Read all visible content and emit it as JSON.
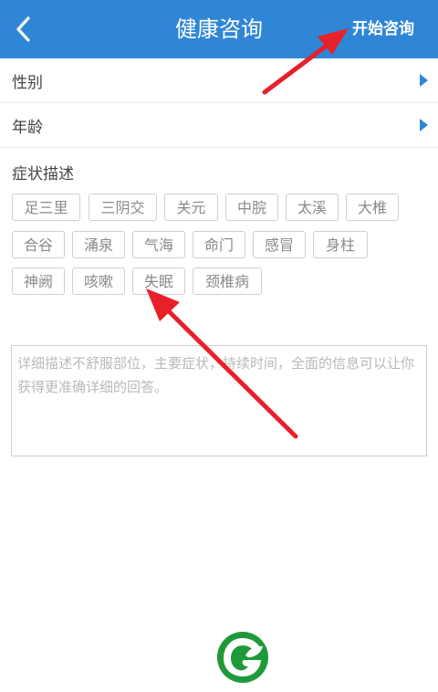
{
  "header": {
    "title": "健康咨询",
    "start_label": "开始咨询"
  },
  "form": {
    "gender_label": "性别",
    "age_label": "年龄",
    "symptom_label": "症状描述"
  },
  "tags": [
    "足三里",
    "三阴交",
    "关元",
    "中脘",
    "太溪",
    "大椎",
    "合谷",
    "涌泉",
    "气海",
    "命门",
    "感冒",
    "身柱",
    "神阙",
    "咳嗽",
    "失眠",
    "颈椎病"
  ],
  "detail": {
    "placeholder": "详细描述不舒服部位，主要症状，持续时间，全面的信息可以让你获得更准确详细的回答。"
  },
  "colors": {
    "header_bg": "#2f86d6",
    "accent": "#2f86d6",
    "annotation_arrow": "#e8202a",
    "logo_green": "#1f9a3a"
  },
  "icons": {
    "back": "chevron-left-icon",
    "row_arrow": "triangle-right-icon",
    "logo": "leaf-g-logo"
  }
}
